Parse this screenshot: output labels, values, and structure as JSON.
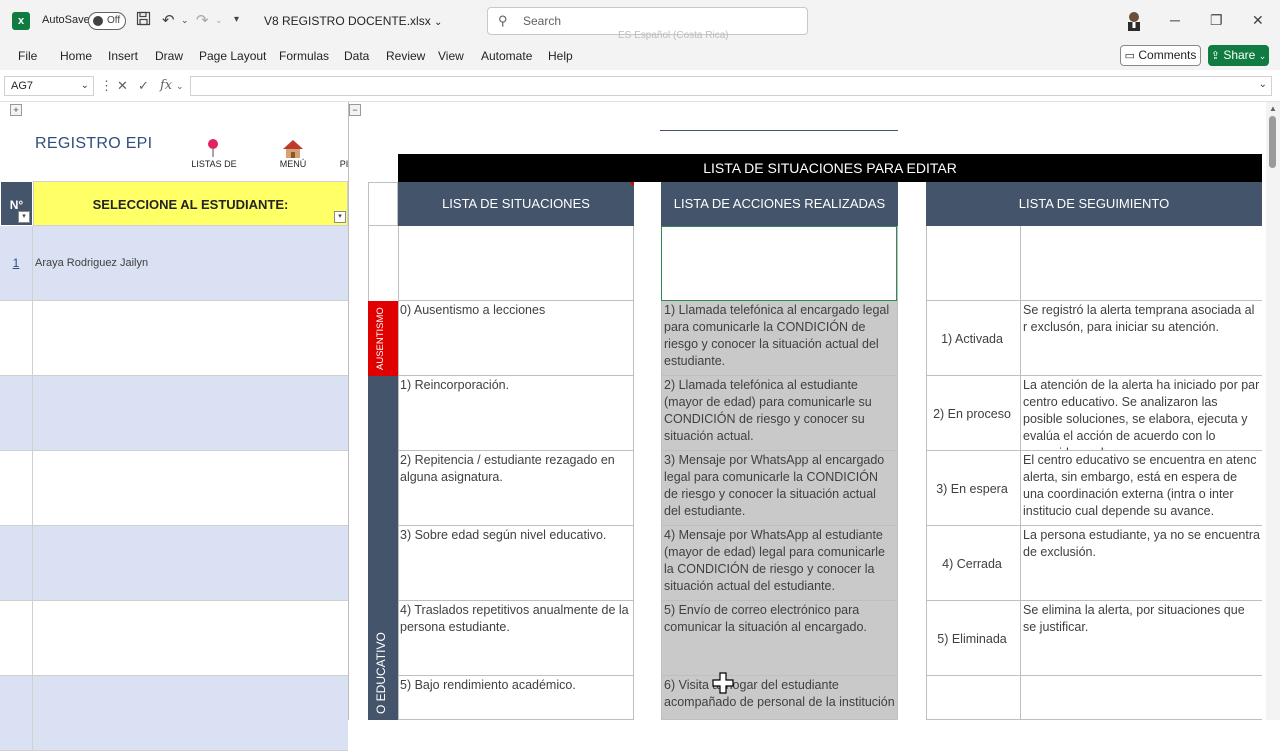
{
  "titlebar": {
    "autosave_label": "AutoSave",
    "autosave_state": "Off",
    "filename": "V8 REGISTRO DOCENTE.xlsx",
    "search_placeholder": "Search",
    "language_hint": "ES Español (Costa Rica)"
  },
  "ribbon": {
    "tabs": [
      "File",
      "Home",
      "Insert",
      "Draw",
      "Page Layout",
      "Formulas",
      "Data",
      "Review",
      "View",
      "Automate",
      "Help"
    ],
    "comments_label": "Comments",
    "share_label": "Share"
  },
  "formula_bar": {
    "name_box": "AG7",
    "fx_symbol": "fx",
    "value": ""
  },
  "sheet": {
    "title": "REGISTRO EPI",
    "shortcuts": [
      "LISTAS DE",
      "MENÚ",
      "PI"
    ],
    "num_header": "N°",
    "select_header": "SELECCIONE AL ESTUDIANTE:",
    "students": [
      {
        "num": "1",
        "name": "Araya Rodriguez Jailyn"
      }
    ],
    "banner": "LISTA DE SITUACIONES PARA EDITAR",
    "headers": {
      "situaciones": "LISTA DE SITUACIONES",
      "acciones": "LISTA DE ACCIONES REALIZADAS",
      "seguimiento": "LISTA DE SEGUIMIENTO"
    },
    "groups": {
      "ausentismo": "AUSENTISMO",
      "educativo": "O EDUCATIVO"
    },
    "situaciones": [
      "0) Ausentismo a lecciones",
      "1) Reincorporación.",
      "2) Repitencia / estudiante rezagado en alguna asignatura.",
      "3) Sobre edad según nivel educativo.",
      "4) Traslados repetitivos anualmente de la persona estudiante.",
      "5) Bajo rendimiento académico."
    ],
    "acciones": [
      "1) Llamada telefónica al encargado legal para comunicarle la CONDICIÓN de riesgo y conocer la situación actual del estudiante.",
      "2) Llamada telefónica al estudiante (mayor de edad) para comunicarle su CONDICIÓN de riesgo y conocer su situación actual.",
      "3) Mensaje por WhatsApp al encargado legal para comunicarle la CONDICIÓN de riesgo y conocer la situación actual del estudiante.",
      "4) Mensaje por WhatsApp al estudiante (mayor de edad) legal para comunicarle la CONDICIÓN de riesgo y conocer la situación actual del estudiante.",
      "5) Envío de correo electrónico para comunicar la situación al encargado.",
      "6) Visita al hogar del estudiante acompañado de personal de la institución"
    ],
    "seguimiento": [
      {
        "estado": "1) Activada",
        "desc": "Se registró la alerta temprana asociada al r exclusón, para iniciar su atención."
      },
      {
        "estado": "2) En proceso",
        "desc": "La atención de la alerta ha iniciado por par centro educativo. Se analizaron las posible soluciones, se elabora, ejecuta y evalúa el acción  de acuerdo con lo requerido por la"
      },
      {
        "estado": "3) En espera",
        "desc": "El centro educativo se encuentra en atenc alerta, sin embargo, está en espera de una coordinación externa (intra o inter institucio cual depende su avance."
      },
      {
        "estado": "4) Cerrada",
        "desc": "La persona estudiante, ya no se encuentra de exclusión."
      },
      {
        "estado": "5) Eliminada",
        "desc": "Se elimina la alerta, por situaciones que se justificar."
      }
    ]
  },
  "colors": {
    "excel_green": "#107c41",
    "header_slate": "#44546a",
    "select_yellow": "#ffff66",
    "row_blue": "#d9e1f2",
    "ausentismo_red": "#e00000",
    "gray_cell": "#c9c9c9"
  }
}
